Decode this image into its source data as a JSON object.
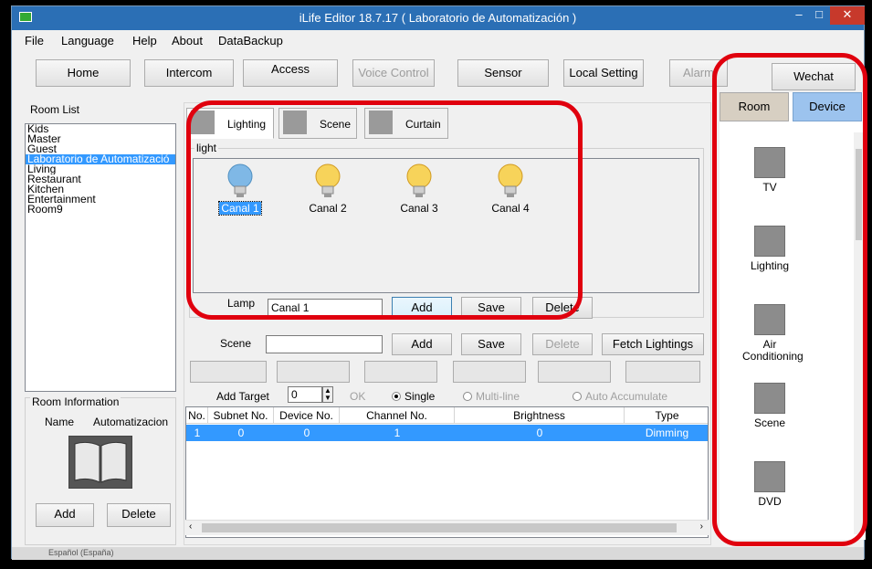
{
  "window": {
    "title": "iLife Editor 18.7.17 ( Laboratorio de Automatización )"
  },
  "menu": {
    "items": [
      "File",
      "Language",
      "Help",
      "About",
      "DataBackup"
    ]
  },
  "toolbar": {
    "home": "Home",
    "intercom": "Intercom",
    "access": "Access",
    "voice_control": "Voice Control",
    "sensor": "Sensor",
    "local_setting": "Local Setting",
    "alarm": "Alarm",
    "wechat": "Wechat"
  },
  "room_list": {
    "title": "Room List",
    "items": [
      "Kids",
      "Master",
      "Guest",
      "Laboratorio de Automatizació",
      "Living",
      "Restaurant",
      "Kitchen",
      "Entertainment",
      "Room9"
    ],
    "selected_index": 3
  },
  "room_info": {
    "title": "Room Information",
    "name_label": "Name",
    "name_value": "Automatizacion",
    "add": "Add",
    "delete": "Delete"
  },
  "tabs": [
    {
      "label": "Lighting",
      "icon": "lighting-icon"
    },
    {
      "label": "Scene",
      "icon": "scene-icon"
    },
    {
      "label": "Curtain",
      "icon": "curtain-icon"
    }
  ],
  "light": {
    "group_label": "light",
    "lamps": [
      "Canal 1",
      "Canal  2",
      "Canal 3",
      "Canal 4"
    ],
    "lamp_label": "Lamp",
    "lamp_value": "Canal 1",
    "add": "Add",
    "save": "Save",
    "delete": "Delete"
  },
  "scene": {
    "label": "Scene",
    "value": "",
    "add": "Add",
    "save": "Save",
    "delete": "Delete",
    "fetch": "Fetch Lightings"
  },
  "target": {
    "label": "Add Target",
    "value": "0",
    "ok": "OK",
    "single": "Single",
    "multi": "Multi-line",
    "accumulate": "Auto Accumulate"
  },
  "grid": {
    "columns": [
      "No.",
      "Subnet No.",
      "Device No.",
      "Channel No.",
      "Brightness",
      "Type"
    ],
    "rows": [
      [
        "1",
        "0",
        "0",
        "1",
        "0",
        "Dimming"
      ]
    ]
  },
  "right_panel": {
    "room": "Room",
    "device": "Device",
    "devices": [
      {
        "label": "TV",
        "icon": "tv-icon"
      },
      {
        "label": "Lighting",
        "icon": "lighting-icon"
      },
      {
        "label": "Air Conditioning",
        "icon": "air-conditioning-icon"
      },
      {
        "label": "Scene",
        "icon": "scene-icon"
      },
      {
        "label": "DVD",
        "icon": "dvd-icon"
      }
    ]
  },
  "status": {
    "language": "Español (España)"
  },
  "colors": {
    "titlebar": "#2b6fb5",
    "selection": "#3399ff",
    "highlight": "#e0000e",
    "device_tab": "#9cc3ee",
    "room_tab": "#d7cfc2"
  }
}
